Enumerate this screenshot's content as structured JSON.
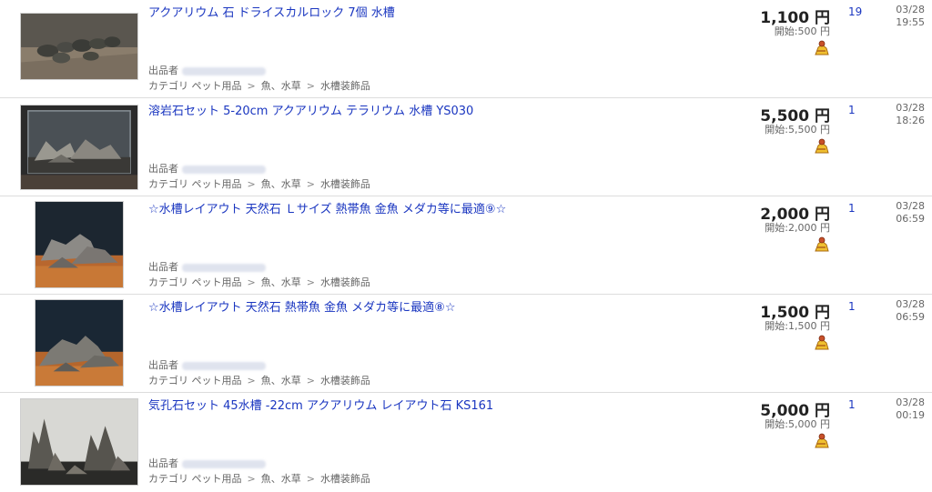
{
  "labels": {
    "seller": "出品者",
    "category_prefix": "カテゴリ",
    "separator": ">",
    "start_prefix": "開始:"
  },
  "icons": {
    "watch": "watch-list-icon"
  },
  "items": [
    {
      "title": "アクアリウム 石 ドライスカルロック 7個 水槽",
      "price": "1,100 円",
      "start_price": "500 円",
      "bids": "19",
      "date": "03/28",
      "time": "19:55",
      "category": [
        "ペット用品",
        "魚、水草",
        "水槽装飾品"
      ]
    },
    {
      "title": "溶岩石セット 5-20cm アクアリウム テラリウム 水槽 YS030",
      "price": "5,500 円",
      "start_price": "5,500 円",
      "bids": "1",
      "date": "03/28",
      "time": "18:26",
      "category": [
        "ペット用品",
        "魚、水草",
        "水槽装飾品"
      ]
    },
    {
      "title": "☆水槽レイアウト 天然石 Ｌサイズ 熱帯魚 金魚 メダカ等に最適⑨☆",
      "price": "2,000 円",
      "start_price": "2,000 円",
      "bids": "1",
      "date": "03/28",
      "time": "06:59",
      "category": [
        "ペット用品",
        "魚、水草",
        "水槽装飾品"
      ]
    },
    {
      "title": "☆水槽レイアウト 天然石 熱帯魚 金魚 メダカ等に最適⑧☆",
      "price": "1,500 円",
      "start_price": "1,500 円",
      "bids": "1",
      "date": "03/28",
      "time": "06:59",
      "category": [
        "ペット用品",
        "魚、水草",
        "水槽装飾品"
      ]
    },
    {
      "title": "気孔石セット 45水槽 -22cm アクアリウム レイアウト石 KS161",
      "price": "5,000 円",
      "start_price": "5,000 円",
      "bids": "1",
      "date": "03/28",
      "time": "00:19",
      "category": [
        "ペット用品",
        "魚、水草",
        "水槽装飾品"
      ]
    }
  ]
}
